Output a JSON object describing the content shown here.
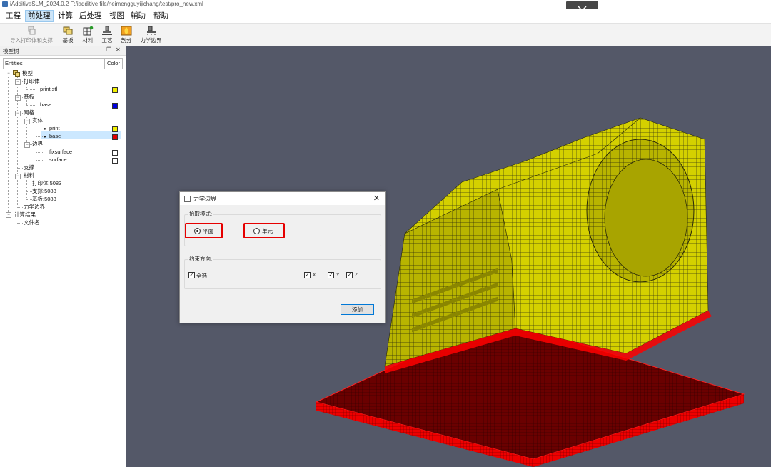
{
  "window": {
    "title": "iAdditiveSLM_2024.0.2 F:/iadditive file/neimengguyijichang/test/pro_new.xml"
  },
  "menu": {
    "items": [
      {
        "label": "工程",
        "active": false
      },
      {
        "label": "前处理",
        "active": true
      },
      {
        "label": "计算",
        "active": false
      },
      {
        "label": "后处理",
        "active": false
      },
      {
        "label": "视图",
        "active": false
      },
      {
        "label": "辅助",
        "active": false
      },
      {
        "label": "帮助",
        "active": false
      }
    ]
  },
  "toolbar": {
    "buttons": [
      {
        "label": "导入打印体和支撑",
        "icon": "import-icon",
        "disabled": true
      },
      {
        "label": "基板",
        "icon": "baseplate-icon"
      },
      {
        "label": "材料",
        "icon": "material-icon"
      },
      {
        "label": "工艺",
        "icon": "process-icon"
      },
      {
        "label": "剖分",
        "icon": "mesh-split-icon"
      },
      {
        "label": "力学边界",
        "icon": "mechanical-boundary-icon"
      }
    ]
  },
  "model_tree": {
    "panel_title": "模型树",
    "columns": {
      "entities": "Entities",
      "color": "Color"
    },
    "nodes": [
      {
        "label": "模型"
      },
      {
        "label": "打印体"
      },
      {
        "label": "print.stl",
        "color": "#f2f000"
      },
      {
        "label": "基板"
      },
      {
        "label": "base",
        "color": "#0000e0"
      },
      {
        "label": "网格"
      },
      {
        "label": "实体"
      },
      {
        "label": "print",
        "color": "#f2f000"
      },
      {
        "label": "base",
        "color": "#e00000",
        "selected": true
      },
      {
        "label": "边界"
      },
      {
        "label": "fixsurface",
        "color": "#ffffff"
      },
      {
        "label": "surface",
        "color": "#ffffff"
      },
      {
        "label": "支撑"
      },
      {
        "label": "材料"
      },
      {
        "label": "打印体:5083"
      },
      {
        "label": "支撑:5083"
      },
      {
        "label": "基板:5083"
      },
      {
        "label": "力学边界"
      },
      {
        "label": "计算结果"
      },
      {
        "label": "文件名"
      }
    ]
  },
  "dialog": {
    "title": "力学边界",
    "pick_mode": {
      "label": "拾取模式:",
      "options": [
        "平面",
        "单元"
      ],
      "selected": "平面"
    },
    "constraint": {
      "label": "约束方向:",
      "all_label": "全选",
      "all_checked": true,
      "axes": [
        "X",
        "Y",
        "Z"
      ]
    },
    "add_button": "添加"
  },
  "colors": {
    "viewport_bg": "#545868",
    "print_mesh": "#d8d400",
    "base_mesh": "#ff0000",
    "highlight": "#e60000",
    "selection": "#cce8ff"
  }
}
